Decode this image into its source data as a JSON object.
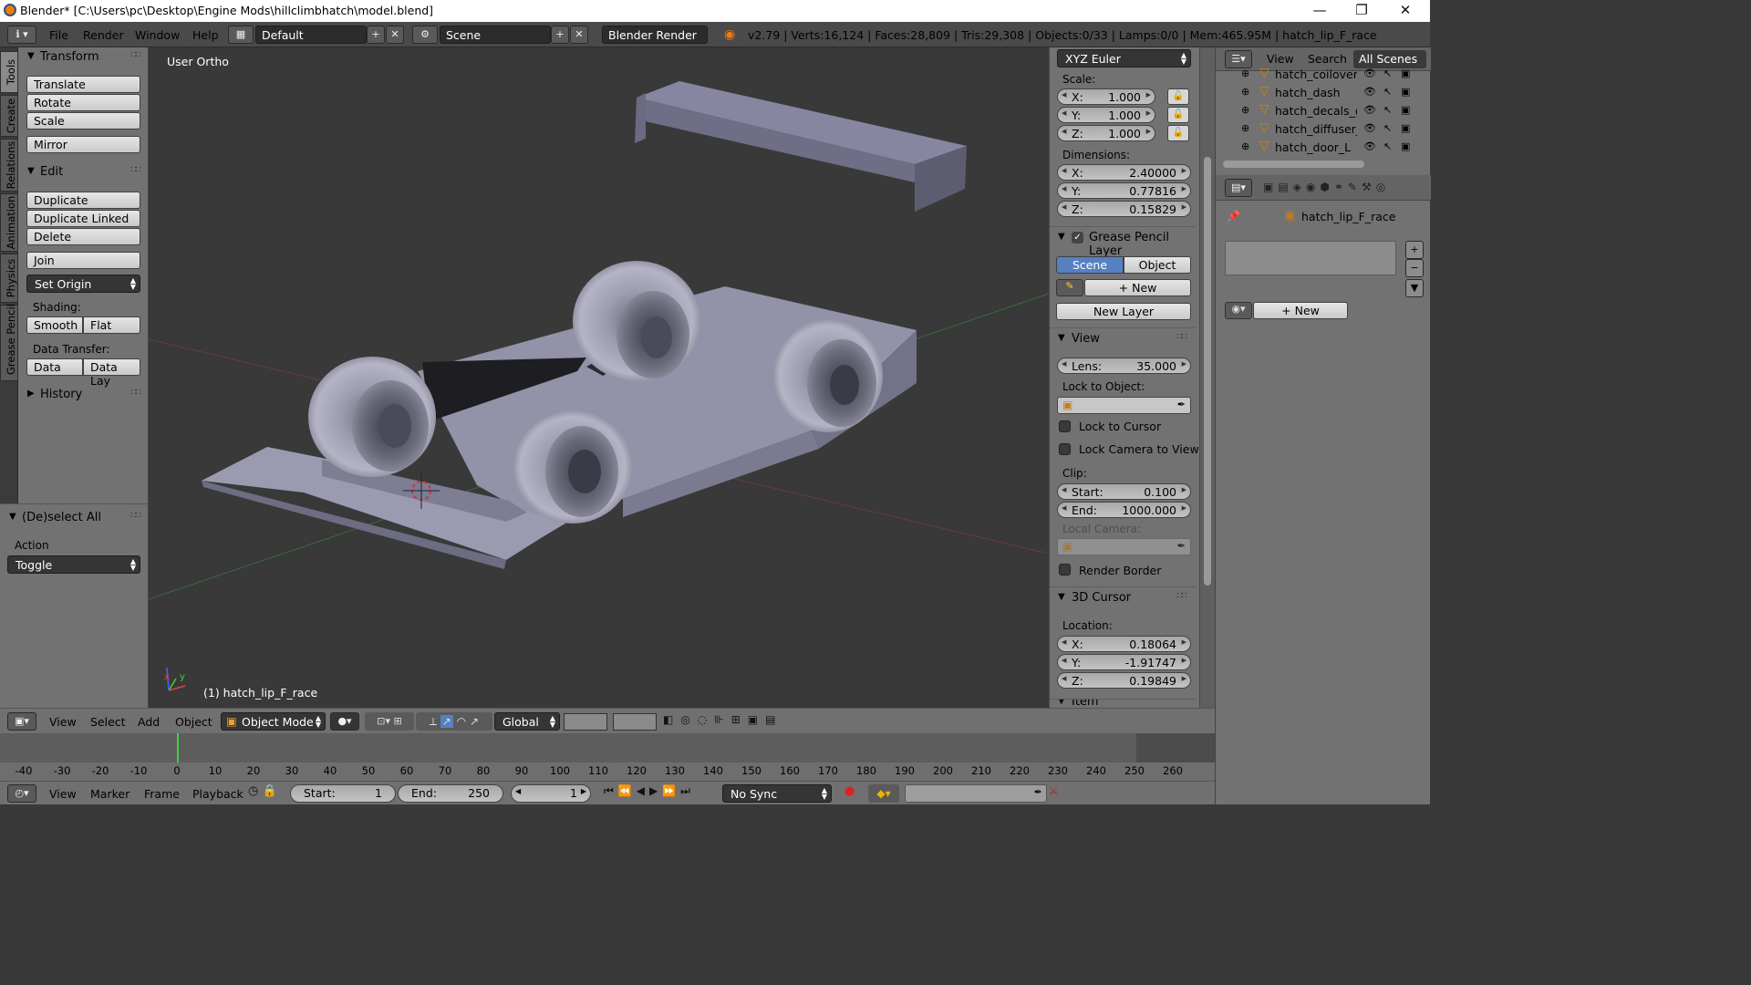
{
  "window": {
    "title": "Blender* [C:\\Users\\pc\\Desktop\\Engine Mods\\hillclimbhatch\\model.blend]",
    "minimize": "—",
    "maximize": "❐",
    "close": "✕"
  },
  "infobar": {
    "menus": [
      "File",
      "Render",
      "Window",
      "Help"
    ],
    "layout": "Default",
    "scene": "Scene",
    "engine": "Blender Render",
    "stats": "v2.79 | Verts:16,124 | Faces:28,809 | Tris:29,308 | Objects:0/33 | Lamps:0/0 | Mem:465.95M | hatch_lip_F_race"
  },
  "vtabs": [
    "Tools",
    "Create",
    "Relations",
    "Animation",
    "Physics",
    "Grease Pencil"
  ],
  "toolshelf": {
    "transform": {
      "header": "Transform",
      "buttons": [
        "Translate",
        "Rotate",
        "Scale",
        "Mirror"
      ]
    },
    "edit": {
      "header": "Edit",
      "buttons": [
        "Duplicate",
        "Duplicate Linked",
        "Delete",
        "Join"
      ],
      "set_origin": "Set Origin",
      "shading_label": "Shading:",
      "smooth": "Smooth",
      "flat": "Flat",
      "data_transfer_label": "Data Transfer:",
      "data": "Data",
      "data_lay": "Data Lay"
    },
    "history": {
      "header": "History"
    }
  },
  "operator": {
    "header": "(De)select All",
    "action_label": "Action",
    "action_value": "Toggle"
  },
  "viewport": {
    "view_label": "User Ortho",
    "object_label": "(1) hatch_lip_F_race",
    "axis_x": "x",
    "axis_y": "y"
  },
  "npanel": {
    "rotation_mode": "XYZ Euler",
    "scale_label": "Scale:",
    "scale": [
      {
        "axis": "X:",
        "value": "1.000"
      },
      {
        "axis": "Y:",
        "value": "1.000"
      },
      {
        "axis": "Z:",
        "value": "1.000"
      }
    ],
    "dimensions_label": "Dimensions:",
    "dimensions": [
      {
        "axis": "X:",
        "value": "2.40000"
      },
      {
        "axis": "Y:",
        "value": "0.77816"
      },
      {
        "axis": "Z:",
        "value": "0.15829"
      }
    ],
    "grease_pencil": {
      "header": "Grease Pencil Layer",
      "scene": "Scene",
      "object": "Object",
      "new": "New",
      "new_layer": "New Layer"
    },
    "view": {
      "header": "View",
      "lens_label": "Lens:",
      "lens_value": "35.000",
      "lock_to_object": "Lock to Object:",
      "lock_to_cursor": "Lock to Cursor",
      "lock_camera": "Lock Camera to View",
      "clip_label": "Clip:",
      "clip_start_label": "Start:",
      "clip_start": "0.100",
      "clip_end_label": "End:",
      "clip_end": "1000.000",
      "local_camera": "Local Camera:",
      "render_border": "Render Border"
    },
    "cursor": {
      "header": "3D Cursor",
      "location_label": "Location:",
      "location": [
        {
          "axis": "X:",
          "value": "0.18064"
        },
        {
          "axis": "Y:",
          "value": "-1.91747"
        },
        {
          "axis": "Z:",
          "value": "0.19849"
        }
      ]
    },
    "item_header": "Item"
  },
  "outliner": {
    "view": "View",
    "search": "Search",
    "filter": "All Scenes",
    "rows": [
      "hatch_coilover_R",
      "hatch_dash",
      "hatch_decals_gau",
      "hatch_diffuser_ra",
      "hatch_door_L"
    ]
  },
  "properties": {
    "object_name": "hatch_lip_F_race",
    "new": "New"
  },
  "view3d_header": {
    "menus": [
      "View",
      "Select",
      "Add",
      "Object"
    ],
    "mode": "Object Mode",
    "orientation": "Global"
  },
  "timeline": {
    "ticks": [
      "-40",
      "-30",
      "-20",
      "-10",
      "0",
      "10",
      "20",
      "30",
      "40",
      "50",
      "60",
      "70",
      "80",
      "90",
      "100",
      "110",
      "120",
      "130",
      "140",
      "150",
      "160",
      "170",
      "180",
      "190",
      "200",
      "210",
      "220",
      "230",
      "240",
      "250",
      "260"
    ],
    "menus": [
      "View",
      "Marker",
      "Frame",
      "Playback"
    ],
    "start_label": "Start:",
    "start": "1",
    "end_label": "End:",
    "end": "250",
    "current": "1",
    "sync": "No Sync"
  }
}
